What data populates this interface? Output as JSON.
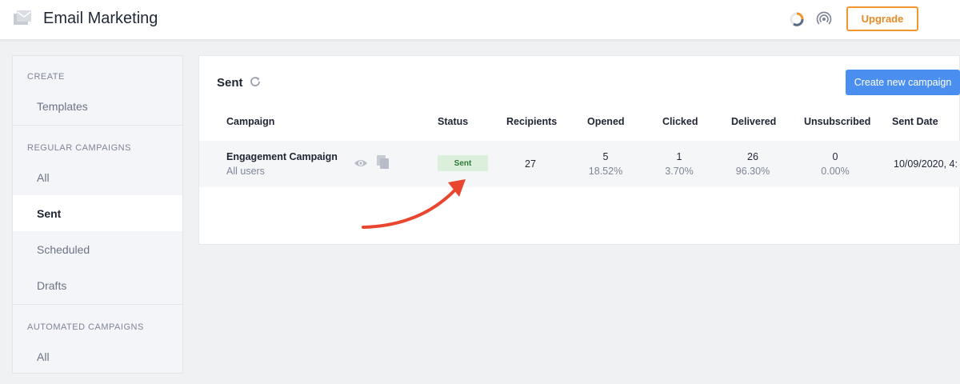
{
  "header": {
    "title": "Email Marketing",
    "upgrade_label": "Upgrade"
  },
  "sidebar": {
    "sections": [
      {
        "label": "CREATE",
        "items": [
          {
            "label": "Templates"
          }
        ]
      },
      {
        "label": "REGULAR CAMPAIGNS",
        "items": [
          {
            "label": "All"
          },
          {
            "label": "Sent",
            "active": true
          },
          {
            "label": "Scheduled"
          },
          {
            "label": "Drafts"
          }
        ]
      },
      {
        "label": "AUTOMATED CAMPAIGNS",
        "items": [
          {
            "label": "All"
          }
        ]
      }
    ]
  },
  "main": {
    "title": "Sent",
    "create_button_label": "Create new campaign",
    "columns": [
      "Campaign",
      "Status",
      "Recipients",
      "Opened",
      "Clicked",
      "Delivered",
      "Unsubscribed",
      "Sent Date"
    ],
    "rows": [
      {
        "campaign_name": "Engagement Campaign",
        "audience": "All users",
        "status": "Sent",
        "recipients": "27",
        "opened": "5",
        "opened_pct": "18.52%",
        "clicked": "1",
        "clicked_pct": "3.70%",
        "delivered": "26",
        "delivered_pct": "96.30%",
        "unsubscribed": "0",
        "unsubscribed_pct": "0.00%",
        "sent_date": "10/09/2020, 4:"
      }
    ]
  },
  "colors": {
    "accent_blue": "#4a8ff0",
    "upgrade_orange": "#f0952f",
    "status_green": "#2f7a36",
    "annotation_red": "#e8462e"
  },
  "icons": [
    "mail-icon",
    "status-ring-icon",
    "broadcast-icon",
    "refresh-icon",
    "eye-icon",
    "copy-icon",
    "annotation-arrow"
  ]
}
